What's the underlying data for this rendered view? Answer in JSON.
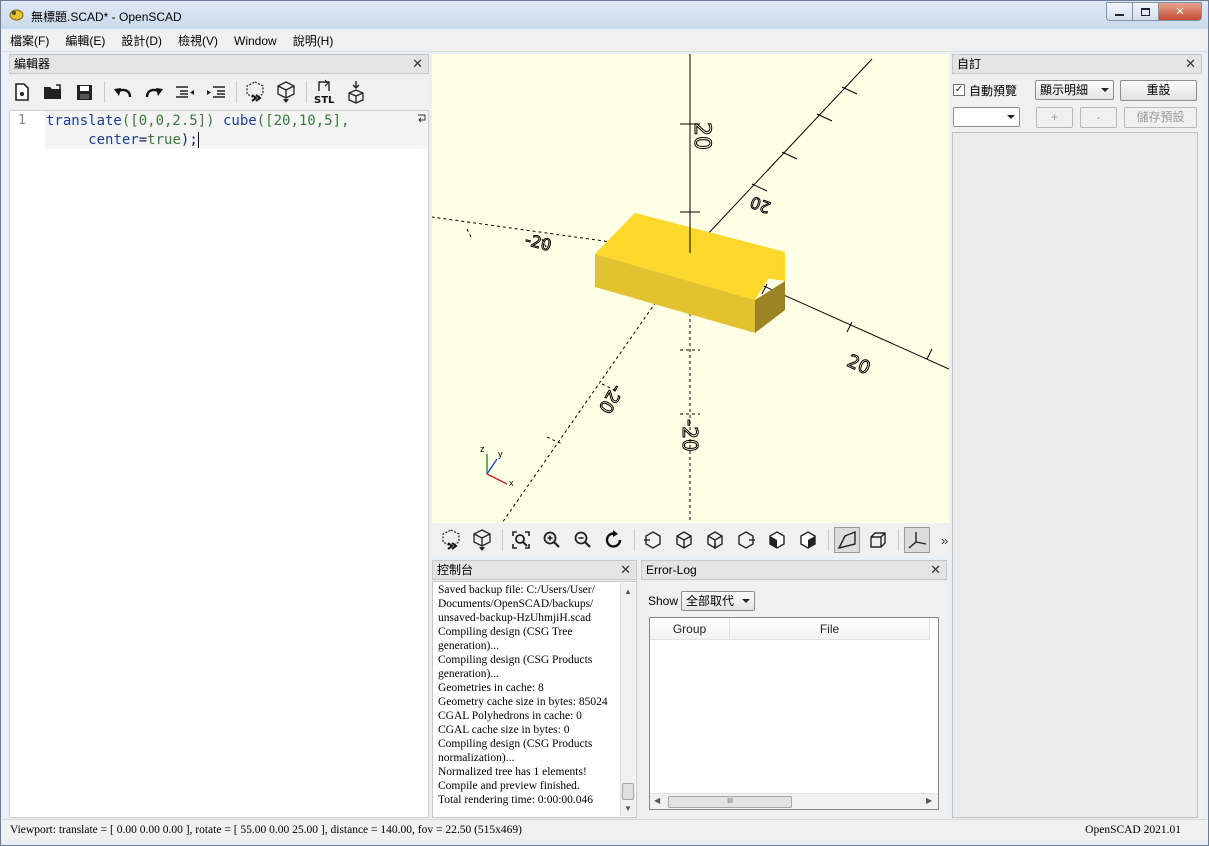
{
  "window": {
    "title": "無標題.SCAD* - OpenSCAD",
    "minimize_icon": "minimize-icon",
    "maximize_icon": "restore-icon",
    "close_icon": "close-icon"
  },
  "menu": [
    "檔案(F)",
    "編輯(E)",
    "設計(D)",
    "檢視(V)",
    "Window",
    "說明(H)"
  ],
  "editor": {
    "title": "編輯器",
    "close": "✕",
    "toolbar_icons": [
      "new-file-icon",
      "open-file-icon",
      "save-icon",
      "undo-icon",
      "redo-icon",
      "unindent-icon",
      "indent-icon",
      "preview-icon",
      "render-icon",
      "export-stl-icon",
      "send-to-print-icon"
    ],
    "line_number": "1",
    "code_line1_kw": "translate",
    "code_line1_args": "([0,0,2.5])",
    "code_line1_kw2": " cube",
    "code_line1_args2": "([20,10,5],",
    "code_line2_arg": "center",
    "code_line2_eq": "=",
    "code_line2_val": "true",
    "code_line2_end": ");"
  },
  "viewport": {
    "axis_ticks": [
      "20",
      "20",
      "20",
      "-20",
      "-20",
      "-20"
    ],
    "axis_small": {
      "z": "z",
      "y": "y",
      "x": "x"
    },
    "toolbar_icons": [
      "preview-icon",
      "render-icon",
      "view-all-icon",
      "zoom-in-icon",
      "zoom-out-icon",
      "reset-view-icon",
      "view-right-icon",
      "view-top-icon",
      "view-bottom-icon",
      "view-left-icon",
      "view-front-icon",
      "view-back-icon",
      "perspective-icon",
      "orthogonal-icon",
      "show-axes-icon"
    ],
    "more": "»"
  },
  "console": {
    "title": "控制台",
    "close": "✕",
    "lines": [
      "Saved backup file: C:/Users/User/",
      "Documents/OpenSCAD/backups/",
      "unsaved-backup-HzUhmjiH.scad",
      "Compiling design (CSG Tree",
      "generation)...",
      "Compiling design (CSG Products",
      "generation)...",
      "Geometries in cache: 8",
      "Geometry cache size in bytes: 85024",
      "CGAL Polyhedrons in cache: 0",
      "CGAL cache size in bytes: 0",
      "Compiling design (CSG Products",
      "normalization)...",
      "Normalized tree has 1 elements!",
      "Compile and preview finished.",
      "Total rendering time: 0:00:00.046"
    ]
  },
  "errorlog": {
    "title": "Error-Log",
    "close": "✕",
    "show_label": "Show",
    "show_value": "全部取代",
    "columns": [
      "Group",
      "File"
    ],
    "hscroll_thumb": "III"
  },
  "customizer": {
    "title": "自訂",
    "close": "✕",
    "auto_preview_label": "自動預覽",
    "auto_preview_checked": "✓",
    "detail_value": "顯示明細",
    "reset_label": "重設",
    "preset_value": "",
    "add_label": "+",
    "remove_label": "-",
    "save_preset_label": "儲存預設"
  },
  "status": {
    "viewport_info": "Viewport: translate = [ 0.00 0.00 0.00 ], rotate = [ 55.00 0.00 25.00 ], distance = 140.00, fov = 22.50 (515x469)",
    "version": "OpenSCAD 2021.01"
  }
}
